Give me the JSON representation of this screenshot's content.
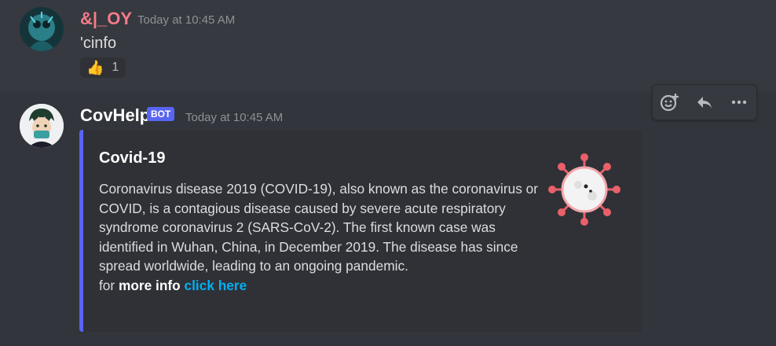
{
  "messages": [
    {
      "author": "&|_OY",
      "timestamp": "Today at 10:45 AM",
      "content": "'cinfo",
      "reaction": {
        "emoji": "👍",
        "count": "1"
      }
    },
    {
      "author": "CovHelp",
      "bot_tag": "BOT",
      "timestamp": "Today at 10:45 AM",
      "embed": {
        "title": "Covid-19",
        "description": "Coronavirus disease 2019 (COVID-19), also known as the coronavirus or COVID, is a contagious disease caused by severe acute respiratory syndrome coronavirus 2 (SARS-CoV-2). The first known case was identified in Wuhan, China, in December 2019. The disease has since spread worldwide, leading to an ongoing pandemic.",
        "footer_prefix": "for ",
        "footer_bold": "more info",
        "footer_link": "click here",
        "accent_color": "#5865f2"
      }
    }
  ],
  "toolbar": {
    "icons": [
      "add-reaction-icon",
      "reply-icon",
      "more-icon"
    ]
  }
}
